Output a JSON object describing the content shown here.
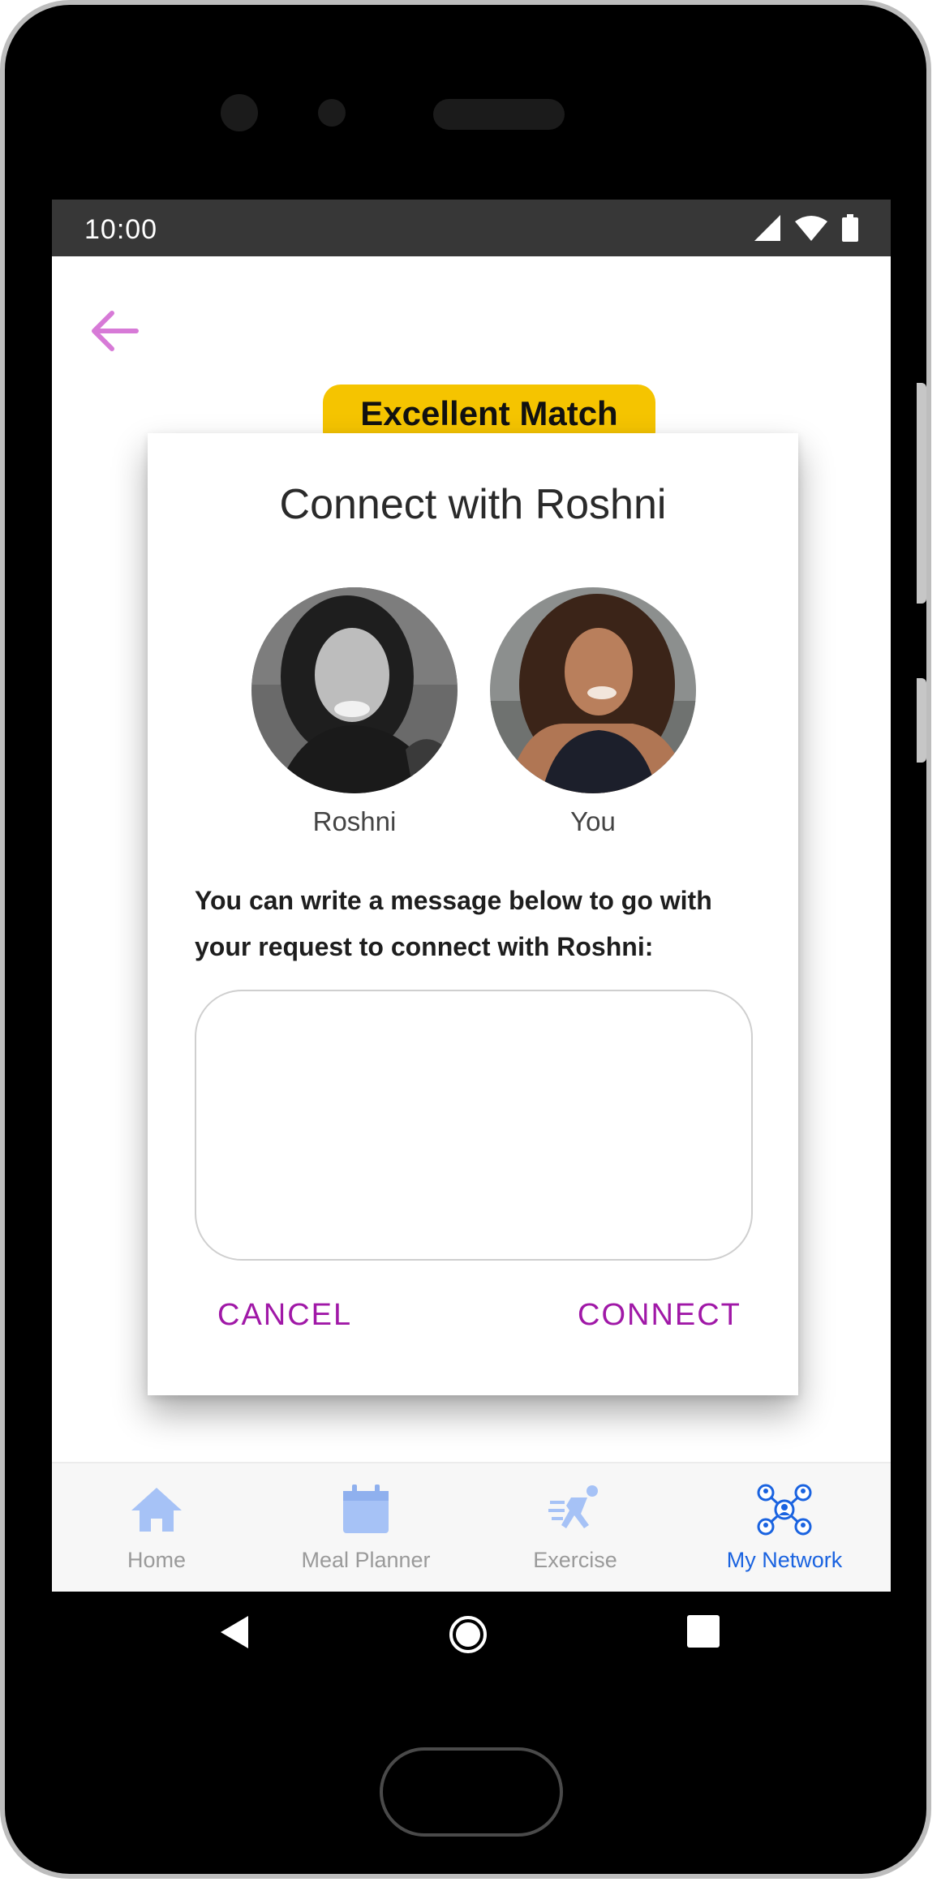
{
  "status_bar": {
    "time": "10:00"
  },
  "match_badge": {
    "text": "Excellent Match"
  },
  "dialog": {
    "title": "Connect with Roshni",
    "people": [
      {
        "name": "Roshni"
      },
      {
        "name": "You"
      }
    ],
    "message_prompt": "You can write a message below to go with your request to connect with Roshni:",
    "message_value": "",
    "cancel_label": "CANCEL",
    "connect_label": "CONNECT"
  },
  "bottom_nav": {
    "items": [
      {
        "label": "Home",
        "icon": "home-icon"
      },
      {
        "label": "Meal Planner",
        "icon": "calendar-icon"
      },
      {
        "label": "Exercise",
        "icon": "runner-icon"
      },
      {
        "label": "My Network",
        "icon": "network-icon",
        "active": true
      }
    ]
  },
  "colors": {
    "accent": "#a018a7",
    "back_arrow": "#d77ad7",
    "badge": "#f5c400",
    "nav_active": "#1a63e0",
    "nav_inactive": "#9a9a9a"
  }
}
